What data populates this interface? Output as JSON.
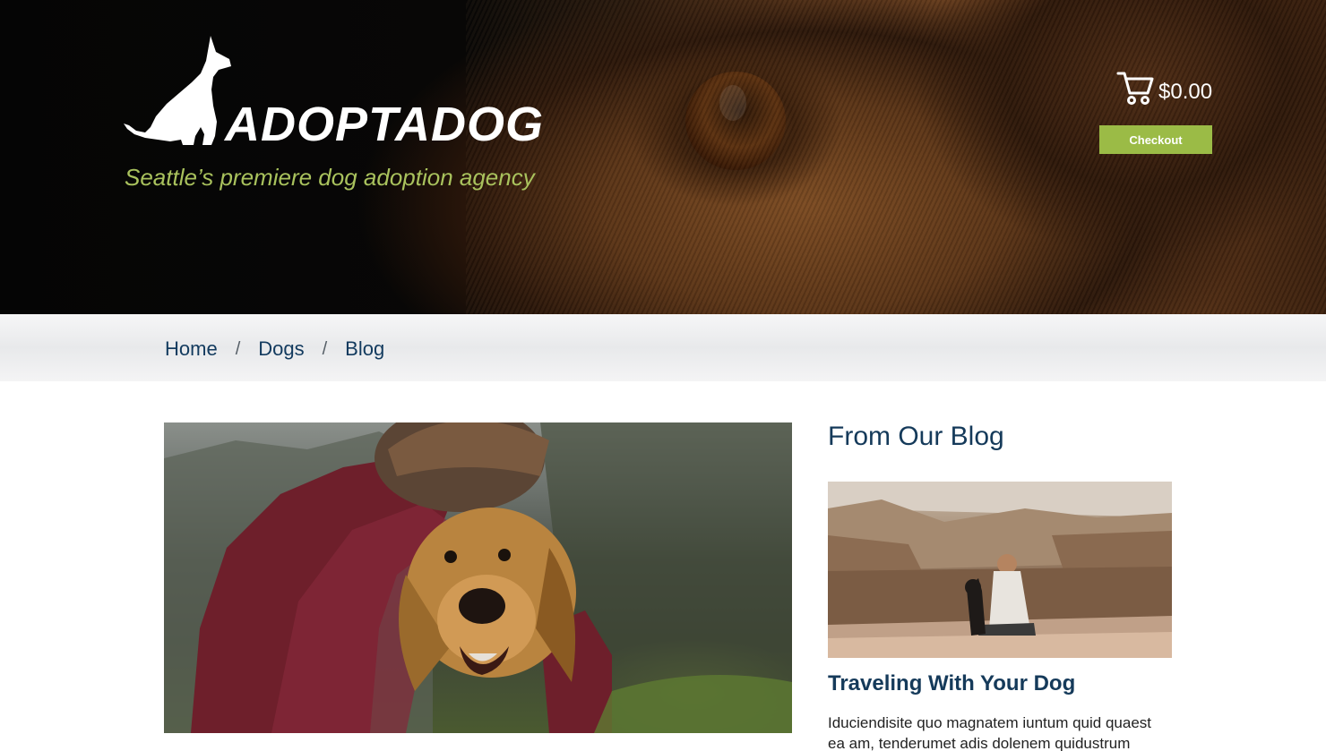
{
  "header": {
    "logo_text": "ADOPTADOG",
    "tagline": "Seattle’s premiere dog adoption agency",
    "cart_total": "$0.00",
    "checkout_label": "Checkout",
    "icons": {
      "logo": "dog-silhouette-icon",
      "cart": "cart-icon"
    },
    "colors": {
      "accent": "#9bbb46",
      "tagline": "#a9c25d"
    }
  },
  "breadcrumb": {
    "items": [
      {
        "label": "Home"
      },
      {
        "label": "Dogs"
      },
      {
        "label": "Blog"
      }
    ],
    "separator": "/"
  },
  "sidebar": {
    "heading": "From Our Blog",
    "post": {
      "title": "Traveling With Your Dog",
      "excerpt": "Iduciendisite quo magnatem iuntum quid quaest ea am, tenderumet adis dolenem quidustrum"
    }
  },
  "colors": {
    "heading": "#153a5a",
    "link": "#123a5e"
  }
}
